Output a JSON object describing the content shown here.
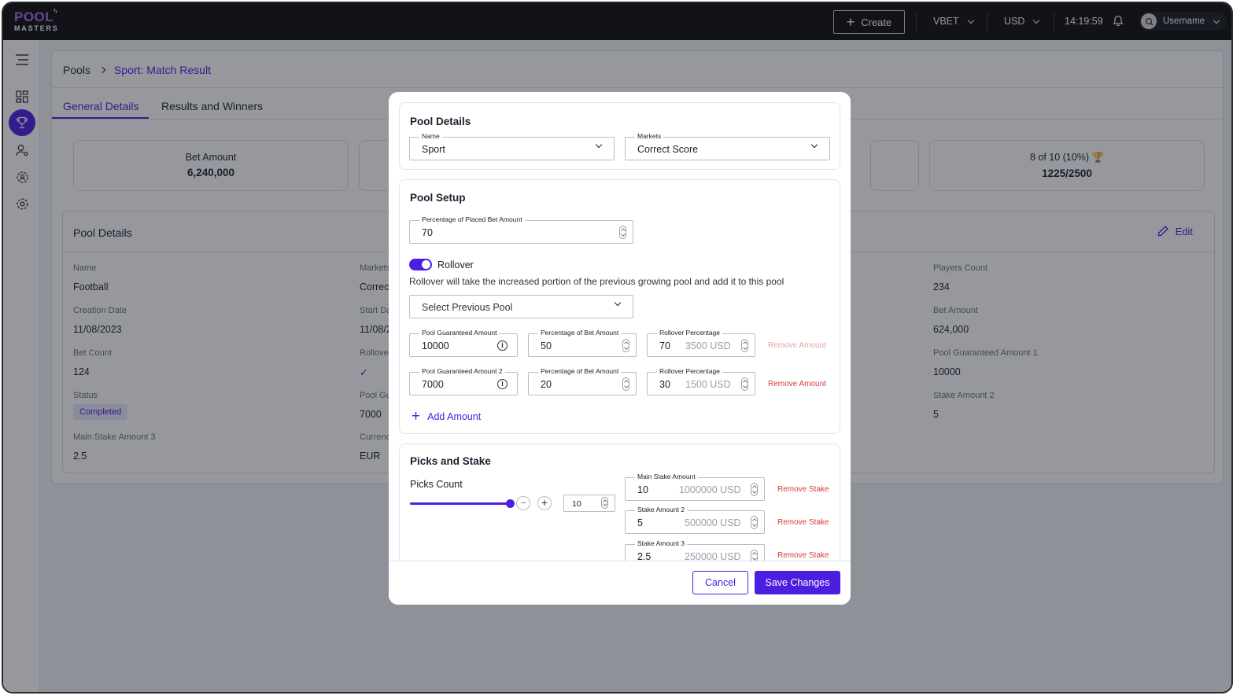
{
  "topbar": {
    "logo_line1": "POOL",
    "logo_line2": "MASTERS",
    "create_label": "Create",
    "brand": "VBET",
    "currency": "USD",
    "time": "14:19:59",
    "username": "Username"
  },
  "sidebar": {
    "icons": [
      "menu-icon",
      "dashboard-icon",
      "trophy-icon",
      "user-settings-icon",
      "group-settings-icon",
      "gear-icon"
    ],
    "active": "trophy-icon"
  },
  "breadcrumb": {
    "root": "Pools",
    "current": "Sport: Match Result"
  },
  "tabs": [
    "General Details",
    "Results and Winners"
  ],
  "stats": {
    "bet_amount_label": "Bet Amount",
    "bet_amount_value": "6,240,000",
    "winners_label": "8 of 10 (10%)",
    "winners_value": "1225/2500"
  },
  "details": {
    "title": "Pool Details",
    "edit_label": "Edit",
    "col1": [
      {
        "label": "Name",
        "value": "Football"
      },
      {
        "label": "Creation Date",
        "value": "11/08/2023"
      },
      {
        "label": "Bet Count",
        "value": "124"
      },
      {
        "label": "Status",
        "value": "Completed"
      },
      {
        "label": "Main Stake Amount 3",
        "value": "2.5"
      }
    ],
    "col2": [
      {
        "label": "Markets",
        "value": "Correct"
      },
      {
        "label": "Start Da",
        "value": "11/08/2"
      },
      {
        "label": "Rollover",
        "value": "✓"
      },
      {
        "label": "Pool Gu",
        "value": "7000"
      },
      {
        "label": "Currenc",
        "value": "EUR"
      }
    ],
    "col3": [
      {
        "label": "Players Count",
        "value": "234"
      },
      {
        "label": "Bet Amount",
        "value": "624,000"
      },
      {
        "label": "Pool Guaranteed Amount 1",
        "value": "10000"
      },
      {
        "label": "Stake Amount 2",
        "value": "5"
      }
    ]
  },
  "modal": {
    "pool_details": {
      "title": "Pool Details",
      "name_label": "Name",
      "name_value": "Sport",
      "markets_label": "Markets",
      "markets_value": "Correct Score"
    },
    "pool_setup": {
      "title": "Pool Setup",
      "pct_placed_label": "Percentage of Placed Bet Amount",
      "pct_placed_value": "70",
      "rollover_label": "Rollover",
      "rollover_on": true,
      "rollover_desc": "Rollover will take the increased portion of the previous growing pool and add it to this pool",
      "prev_pool_placeholder": "Select Previous Pool",
      "amounts": [
        {
          "g_label": "Pool Guaranteed Amount",
          "g_value": "10000",
          "p_label": "Percentage of Bet Amount",
          "p_value": "50",
          "r_label": "Rollover Percentage",
          "r_value": "70",
          "r_usd": "3500 USD",
          "remove": "Remove Amount"
        },
        {
          "g_label": "Pool Guaranteed Amount 2",
          "g_value": "7000",
          "p_label": "Percentage of Bet Amount",
          "p_value": "20",
          "r_label": "Rollover Percentage",
          "r_value": "30",
          "r_usd": "1500 USD",
          "remove": "Remove Amount"
        }
      ],
      "add_amount": "Add Amount"
    },
    "picks": {
      "title": "Picks and Stake",
      "picks_count_label": "Picks Count",
      "picks_count_value": "10",
      "slider_fraction": 1.0,
      "stakes": [
        {
          "label": "Main Stake Amount",
          "value": "10",
          "usd": "1000000 USD",
          "remove": "Remove Stake"
        },
        {
          "label": "Stake Amount 2",
          "value": "5",
          "usd": "500000 USD",
          "remove": "Remove Stake"
        },
        {
          "label": "Stake Amount 3",
          "value": "2.5",
          "usd": "250000 USD",
          "remove": "Remove Stake"
        }
      ]
    },
    "cancel_label": "Cancel",
    "save_label": "Save Changes"
  },
  "colors": {
    "accent": "#4b1ee0",
    "danger": "#d43b3b",
    "topbar": "#0d0d0f"
  }
}
